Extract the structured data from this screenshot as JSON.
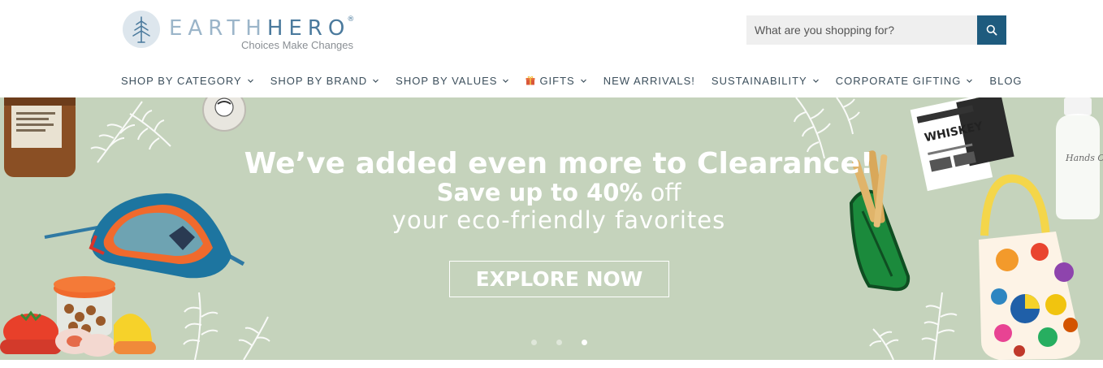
{
  "logo": {
    "name_part1": "EARTH",
    "name_part2": "HERO",
    "registered": "®",
    "tagline": "Choices Make Changes",
    "icon": "tree-icon"
  },
  "search": {
    "placeholder": "What are you shopping for?",
    "icon": "search-icon"
  },
  "nav": {
    "items": [
      {
        "label": "SHOP BY CATEGORY",
        "dropdown": true
      },
      {
        "label": "SHOP BY BRAND",
        "dropdown": true
      },
      {
        "label": "SHOP BY VALUES",
        "dropdown": true
      },
      {
        "label": "GIFTS",
        "dropdown": true,
        "icon": "gift-icon"
      },
      {
        "label": "NEW ARRIVALS!",
        "dropdown": false
      },
      {
        "label": "SUSTAINABILITY",
        "dropdown": true
      },
      {
        "label": "CORPORATE GIFTING",
        "dropdown": true
      },
      {
        "label": "BLOG",
        "dropdown": false
      }
    ]
  },
  "hero": {
    "headline": "We’ve added even more to Clearance!",
    "line2_bold": "Save up to 40%",
    "line2_rest": " off",
    "line3": "your eco-friendly favorites",
    "cta": "EXPLORE NOW",
    "slides": 3,
    "active_slide": 3,
    "product_texts": {
      "whiskey_label": "WHISKEY",
      "bottle_label": "Hands On Deck"
    }
  },
  "colors": {
    "accent": "#1e5b7e",
    "banner_bg": "#c5d3bc",
    "nav_text": "#3c4f5c",
    "logo_light": "#9bb5c9",
    "logo_dark": "#4b7a9d"
  }
}
